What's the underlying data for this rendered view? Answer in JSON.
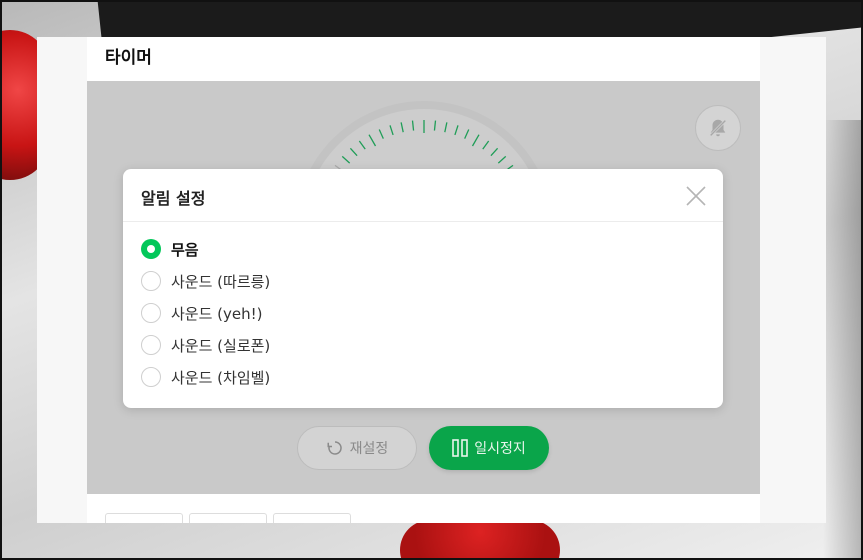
{
  "card": {
    "title": "타이머"
  },
  "controls": {
    "reset_label": "재설정",
    "pause_label": "일시정지"
  },
  "alarm_modal": {
    "title": "알림 설정",
    "options": [
      {
        "label": "무음",
        "selected": true
      },
      {
        "label": "사운드 (따르릉)",
        "selected": false
      },
      {
        "label": "사운드 (yeh!)",
        "selected": false
      },
      {
        "label": "사운드 (실로폰)",
        "selected": false
      },
      {
        "label": "사운드 (차임벨)",
        "selected": false
      }
    ]
  },
  "colors": {
    "accent": "#03c75a",
    "overlay": "#c9c9c9",
    "pause_button": "#0aa54a"
  },
  "icons": {
    "mute": "bell-off-icon",
    "close": "close-icon",
    "reset": "reset-icon",
    "pause": "pause-icon"
  }
}
